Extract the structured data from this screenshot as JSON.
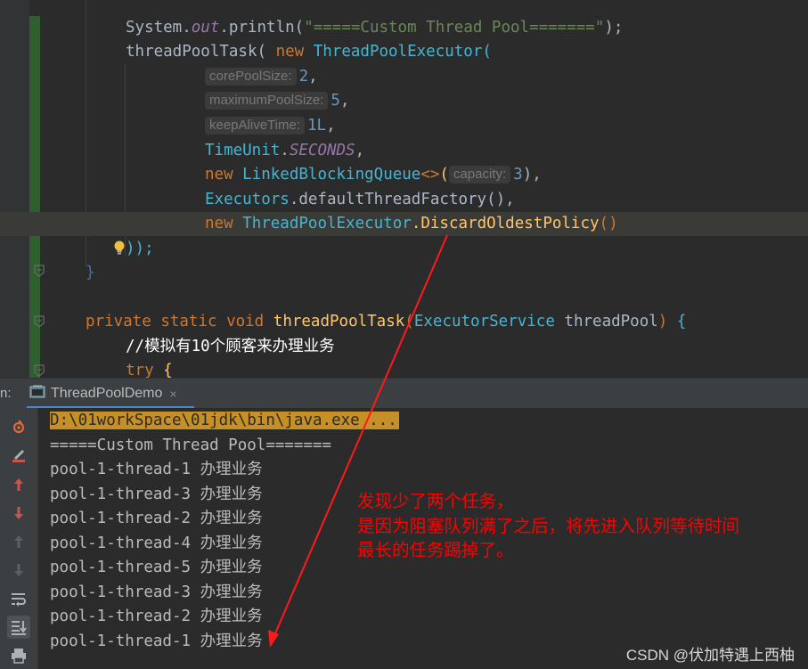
{
  "editor": {
    "lines": {
      "l1": {
        "println": "System.",
        "out": "out",
        "dot": ".println(",
        "str": "\"=====Custom Thread Pool=======\"",
        "end": ");"
      },
      "l2": {
        "call": "threadPoolTask( ",
        "new": "new",
        "cls": "ThreadPoolExecutor",
        "paren": "("
      },
      "l3": {
        "hint": "corePoolSize:",
        "value": "2",
        "comma": ","
      },
      "l4": {
        "hint": "maximumPoolSize:",
        "value": "5",
        "comma": ","
      },
      "l5": {
        "hint": "keepAliveTime:",
        "value": "1L",
        "comma": ","
      },
      "l6": {
        "cls": "TimeUnit",
        "dot": ".",
        "field": "SECONDS",
        "comma": ","
      },
      "l7": {
        "new": "new",
        "cls": "LinkedBlockingQueue",
        "diamond": "<>",
        "paren": "(",
        "hint": "capacity:",
        "value": "3",
        "end": "),"
      },
      "l8": {
        "cls": "Executors",
        "rest": ".defaultThreadFactory(),",
        "": ""
      },
      "l9": {
        "new": "new",
        "cls": "ThreadPoolExecutor",
        "rest": ".DiscardOldestPolicy",
        "parens": "()"
      },
      "l10": {
        "text": "));"
      },
      "l11": {
        "text": "}"
      },
      "l12": {
        "private": "private",
        "static": "static",
        "void": "void",
        "fn": "threadPoolTask",
        "open": "(",
        "cls": "ExecutorService",
        "param": " threadPool",
        "close": ")",
        "brace": " {"
      },
      "l13": {
        "text": "//模拟有10个顾客来办理业务"
      },
      "l14": {
        "try": "try",
        "brace": " {"
      }
    }
  },
  "run": {
    "label": "n:",
    "tab_title": "ThreadPoolDemo",
    "tab_close": "×"
  },
  "console": {
    "command": "D:\\01workSpace\\01jdk\\bin\\java.exe ...",
    "lines": [
      "=====Custom Thread Pool=======",
      "pool-1-thread-1 办理业务",
      "pool-1-thread-3 办理业务",
      "pool-1-thread-2 办理业务",
      "pool-1-thread-4 办理业务",
      "pool-1-thread-5 办理业务",
      "pool-1-thread-3 办理业务",
      "pool-1-thread-2 办理业务",
      "pool-1-thread-1 办理业务"
    ]
  },
  "annotation": {
    "lines": [
      "发现少了两个任务，",
      "是因为阻塞队列满了之后，将先进入队列等待时间",
      "最长的任务踢掉了。"
    ],
    "color": "#ff0000"
  },
  "watermark": "CSDN @伏加特遇上西柚",
  "toolbar_icons": [
    "rerun-icon",
    "clear-icon",
    "up-arrow-icon",
    "down-arrow-icon",
    "up-disabled-icon",
    "down-disabled-icon",
    "soft-wrap-icon",
    "scroll-to-end-icon",
    "print-icon"
  ],
  "colors": {
    "keyword": "#cc7832",
    "class": "#46b5d1",
    "method": "#ffc66d",
    "number": "#6897bb",
    "string": "#6a8759",
    "static_field": "#9876aa"
  }
}
